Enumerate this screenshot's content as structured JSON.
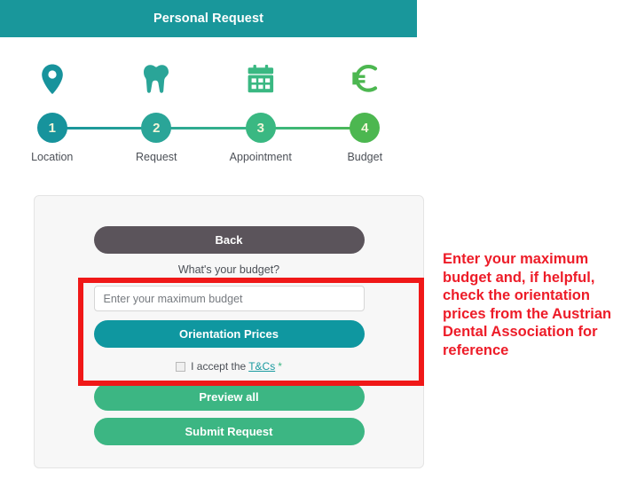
{
  "header": {
    "title": "Personal Request",
    "bg_color": "#19979b"
  },
  "wizard": {
    "steps": [
      {
        "number": "1",
        "label": "Location",
        "icon": "location-pin-icon",
        "color": "#17939c"
      },
      {
        "number": "2",
        "label": "Request",
        "icon": "tooth-icon",
        "color": "#2aa598"
      },
      {
        "number": "3",
        "label": "Appointment",
        "icon": "calendar-icon",
        "color": "#3ab882"
      },
      {
        "number": "4",
        "label": "Budget",
        "icon": "euro-icon",
        "color": "#4cb750"
      }
    ]
  },
  "form": {
    "back_label": "Back",
    "question": "What's your budget?",
    "budget_placeholder": "Enter your maximum budget",
    "budget_value": "",
    "orientation_prices_label": "Orientation Prices",
    "terms_prefix": "I accept the",
    "terms_link": "T&Cs",
    "terms_required_marker": "*",
    "terms_checked": false,
    "preview_label": "Preview all",
    "submit_label": "Submit Request"
  },
  "annotation": {
    "text": "Enter your maximum budget and, if helpful, check the orientation prices from the Austrian Dental Association for reference",
    "color": "#ed1c28"
  }
}
